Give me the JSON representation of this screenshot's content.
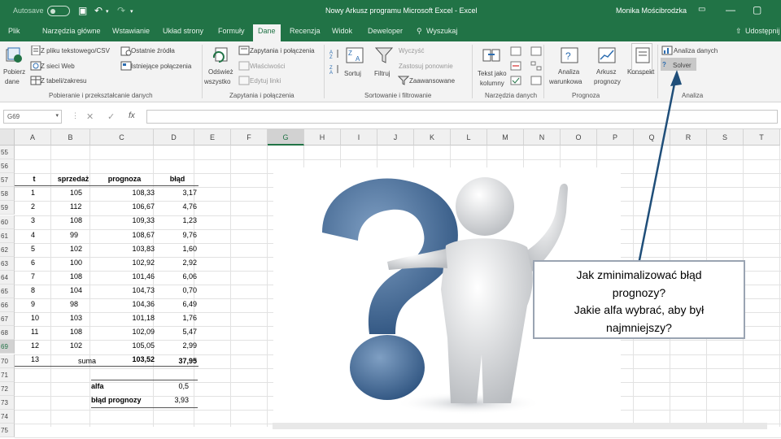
{
  "titlebar": {
    "autosave_label": "Autosave",
    "document_title": "Nowy Arkusz programu Microsoft Excel - Excel",
    "user": "Monika Mościbrodzka",
    "bg_color": "#217346"
  },
  "tabs": [
    "Plik",
    "Narzędzia główne",
    "Wstawianie",
    "Układ strony",
    "Formuły",
    "Dane",
    "Recenzja",
    "Widok",
    "Deweloper",
    "Wyszukaj",
    "Udostępnij"
  ],
  "active_tab": "Dane",
  "ribbon": {
    "get_data": {
      "top": "Pobierz",
      "bottom": "dane"
    },
    "from_text": "Z pliku tekstowego/CSV",
    "from_web": "Z sieci Web",
    "from_table": "Z tabeli/zakresu",
    "recent_sources": "Ostatnie źródła",
    "existing_conn": "Istniejące połączenia",
    "refresh": {
      "top": "Odśwież",
      "bottom": "wszystko"
    },
    "queries": "Zapytania i połączenia",
    "properties": "Właściwości",
    "edit_links": "Edytuj linki",
    "sort": "Sortuj",
    "filter": "Filtruj",
    "clear": "Wyczyść",
    "reapply": "Zastosuj ponownie",
    "advanced": "Zaawansowane",
    "text_to_columns": {
      "top": "Tekst jako",
      "bottom": "kolumny"
    },
    "what_if": {
      "top": "Analiza",
      "bottom": "warunkowa"
    },
    "forecast_sheet": {
      "top": "Arkusz",
      "bottom": "prognozy"
    },
    "outline": "Konspekt",
    "data_analysis": "Analiza danych",
    "solver": "Solver",
    "groups": {
      "get_transform": "Pobieranie i przekształcanie danych",
      "queries": "Zapytania i połączenia",
      "sort_filter": "Sortowanie i filtrowanie",
      "data_tools": "Narzędzia danych",
      "forecast": "Prognoza",
      "analysis": "Analiza"
    }
  },
  "formula_bar": {
    "name_box": "G69",
    "fx": "fx",
    "cancel": "✕",
    "enter": "✓",
    "value": ""
  },
  "columns": [
    "A",
    "B",
    "C",
    "D",
    "E",
    "F",
    "G",
    "H",
    "I",
    "J",
    "K",
    "L",
    "M",
    "N",
    "O",
    "P",
    "Q",
    "R",
    "S",
    "T"
  ],
  "selected_column": "G",
  "rows": [
    "55",
    "56",
    "57",
    "58",
    "59",
    "60",
    "61",
    "62",
    "63",
    "64",
    "65",
    "66",
    "67",
    "68",
    "69",
    "70",
    "71",
    "72",
    "73",
    "74",
    "75"
  ],
  "selected_row": "69",
  "table": {
    "headers": {
      "t": "t",
      "sales": "sprzedaż",
      "forecast": "prognoza",
      "error": "błąd"
    },
    "data": [
      {
        "t": "1",
        "sales": "105",
        "forecast": "108,33",
        "error": "3,17"
      },
      {
        "t": "2",
        "sales": "112",
        "forecast": "106,67",
        "error": "4,76"
      },
      {
        "t": "3",
        "sales": "108",
        "forecast": "109,33",
        "error": "1,23"
      },
      {
        "t": "4",
        "sales": "99",
        "forecast": "108,67",
        "error": "9,76"
      },
      {
        "t": "5",
        "sales": "102",
        "forecast": "103,83",
        "error": "1,60"
      },
      {
        "t": "6",
        "sales": "100",
        "forecast": "102,92",
        "error": "2,92"
      },
      {
        "t": "7",
        "sales": "108",
        "forecast": "101,46",
        "error": "6,06"
      },
      {
        "t": "8",
        "sales": "104",
        "forecast": "104,73",
        "error": "0,70"
      },
      {
        "t": "9",
        "sales": "98",
        "forecast": "104,36",
        "error": "6,49"
      },
      {
        "t": "10",
        "sales": "103",
        "forecast": "101,18",
        "error": "1,76"
      },
      {
        "t": "11",
        "sales": "108",
        "forecast": "102,09",
        "error": "5,47"
      },
      {
        "t": "12",
        "sales": "102",
        "forecast": "105,05",
        "error": "2,99"
      },
      {
        "t": "13",
        "sales": "",
        "forecast": "103,52",
        "error": "-"
      }
    ],
    "sum_label": "suma",
    "sum_value": "37,95",
    "alpha_label": "alfa",
    "alpha_value": "0,5",
    "error_label": "błąd prognozy",
    "error_value": "3,93"
  },
  "callout": {
    "line1": "Jak zminimalizować błąd",
    "line2": "prognozy?",
    "line3": "Jakie alfa wybrać, aby był",
    "line4": "najmniejszy?"
  },
  "colors": {
    "excel_green": "#217346",
    "figure_blue": "#4a6f99",
    "arrow": "#1f4e79"
  }
}
